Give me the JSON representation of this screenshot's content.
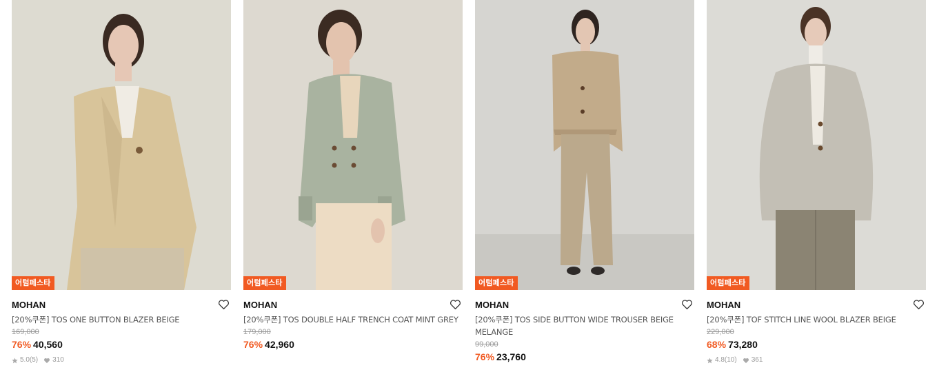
{
  "products": [
    {
      "badge": "어텀페스타",
      "brand": "MOHAN",
      "name": "[20%쿠폰] TOS ONE BUTTON BLAZER BEIGE",
      "original_price": "169,000",
      "discount": "76%",
      "price": "40,560",
      "rating": "5.0",
      "reviews": "(5)",
      "likes": "310",
      "image_colors": {
        "bg": "#d9d6cc",
        "coat": "#d8c49a",
        "pants": "#cfc2a8",
        "skin": "#e6c7b5",
        "hair": "#3a2a22"
      }
    },
    {
      "badge": "어텀페스타",
      "brand": "MOHAN",
      "name": "[20%쿠폰] TOS DOUBLE HALF TRENCH COAT MINT GREY",
      "original_price": "179,000",
      "discount": "76%",
      "price": "42,960",
      "image_colors": {
        "bg": "#ddd9d0",
        "coat": "#a9b3a0",
        "pants": "#eddcc4",
        "skin": "#e3c3ae",
        "hair": "#3b2b22"
      }
    },
    {
      "badge": "어텀페스타",
      "brand": "MOHAN",
      "name": "[20%쿠폰] TOS SIDE BUTTON WIDE TROUSER BEIGE MELANGE",
      "original_price": "99,000",
      "discount": "76%",
      "price": "23,760",
      "image_colors": {
        "bg": "#d6d5d1",
        "coat": "#c2ab8a",
        "pants": "#bba98c",
        "skin": "#e3c6b3",
        "hair": "#2e2420"
      }
    },
    {
      "badge": "어텀페스타",
      "brand": "MOHAN",
      "name": "[20%쿠폰] TOF STITCH LINE WOOL BLAZER BEIGE",
      "original_price": "229,000",
      "discount": "68%",
      "price": "73,280",
      "rating": "4.8",
      "reviews": "(10)",
      "likes": "361",
      "image_colors": {
        "bg": "#dcdbd6",
        "coat": "#c3bfb5",
        "pants": "#8b8473",
        "skin": "#e6cab9",
        "hair": "#4a3326"
      }
    }
  ]
}
